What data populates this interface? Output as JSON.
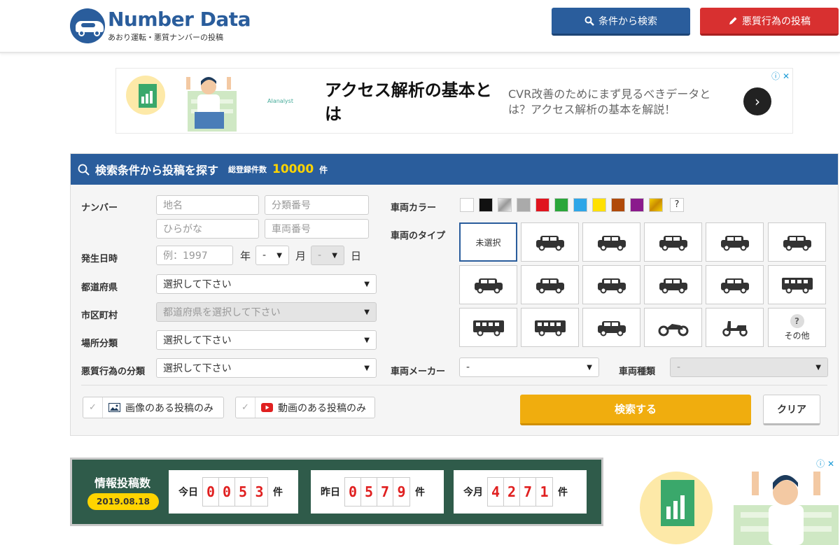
{
  "header": {
    "logo_title": "Number Data",
    "logo_subtitle": "あおり運転・悪質ナンバーの投稿",
    "search_button": "条件から検索",
    "post_button": "悪質行為の投稿",
    "search_icon": "search-icon",
    "post_icon": "pencil-icon"
  },
  "ad_top": {
    "brand": "AIanalyst",
    "headline": "アクセス解析の基本とは",
    "description": "CVR改善のためにまず見るべきデータとは？アクセス解析の基本を解説！",
    "adchoices": "ⓘ ✕",
    "arrow": "›"
  },
  "search": {
    "title": "検索条件から投稿を探す",
    "registered_label": "総登録件数",
    "registered_count": "10000",
    "registered_unit": "件",
    "number_label": "ナンバー",
    "placeholders": {
      "region": "地名",
      "class_number": "分類番号",
      "hiragana": "ひらがな",
      "vehicle_number": "車両番号",
      "year": "例：1997"
    },
    "date_label": "発生日時",
    "year_unit": "年",
    "month_value": "-",
    "month_unit": "月",
    "day_value": "-",
    "day_unit": "日",
    "prefecture_label": "都道府県",
    "prefecture_value": "選択して下さい",
    "city_label": "市区町村",
    "city_value": "都道府県を選択して下さい",
    "place_label": "場所分類",
    "place_value": "選択して下さい",
    "behavior_label": "悪質行為の分類",
    "behavior_value": "選択して下さい",
    "color_label": "車両カラー",
    "colors": [
      "#ffffff",
      "#111111",
      "silver-gradient",
      "#aaaaaa",
      "#e0141e",
      "#2aa63a",
      "#2ea6e8",
      "#ffe000",
      "#b04a0a",
      "#8a1a8c",
      "gold-gradient"
    ],
    "color_unknown": "?",
    "type_label": "車両のタイプ",
    "type_unselected": "未選択",
    "type_other_icon": "?",
    "type_other": "その他",
    "vehicle_icons": [
      "minivan-icon",
      "truck-icon",
      "wagon-icon",
      "van-icon",
      "sedan-icon",
      "convertible-icon",
      "suv-icon",
      "coupe-icon",
      "kei-car-icon",
      "pickup-icon",
      "camper-icon",
      "box-truck-icon",
      "bus-icon",
      "taxi-icon",
      "motorcycle-icon",
      "scooter-icon"
    ],
    "maker_label": "車両メーカー",
    "maker_value": "-",
    "model_label": "車両種類",
    "model_value": "-",
    "image_only": "画像のある投稿のみ",
    "video_only": "動画のある投稿のみ",
    "submit": "検索する",
    "clear": "クリア",
    "check": "✓"
  },
  "stats": {
    "title": "情報投稿数",
    "date": "2019.08.18",
    "today_label": "今日",
    "today_digits": [
      "0",
      "0",
      "5",
      "3"
    ],
    "yesterday_label": "昨日",
    "yesterday_digits": [
      "0",
      "5",
      "7",
      "9"
    ],
    "month_label": "今月",
    "month_digits": [
      "4",
      "2",
      "7",
      "1"
    ],
    "unit": "件"
  },
  "ad_side": {
    "adchoices": "ⓘ ✕"
  },
  "colors": {
    "primary": "#2a5d9c",
    "danger": "#d83030",
    "accent": "#f0ad0e",
    "stats_bg": "#2f5b4a",
    "highlight": "#ffd400"
  }
}
